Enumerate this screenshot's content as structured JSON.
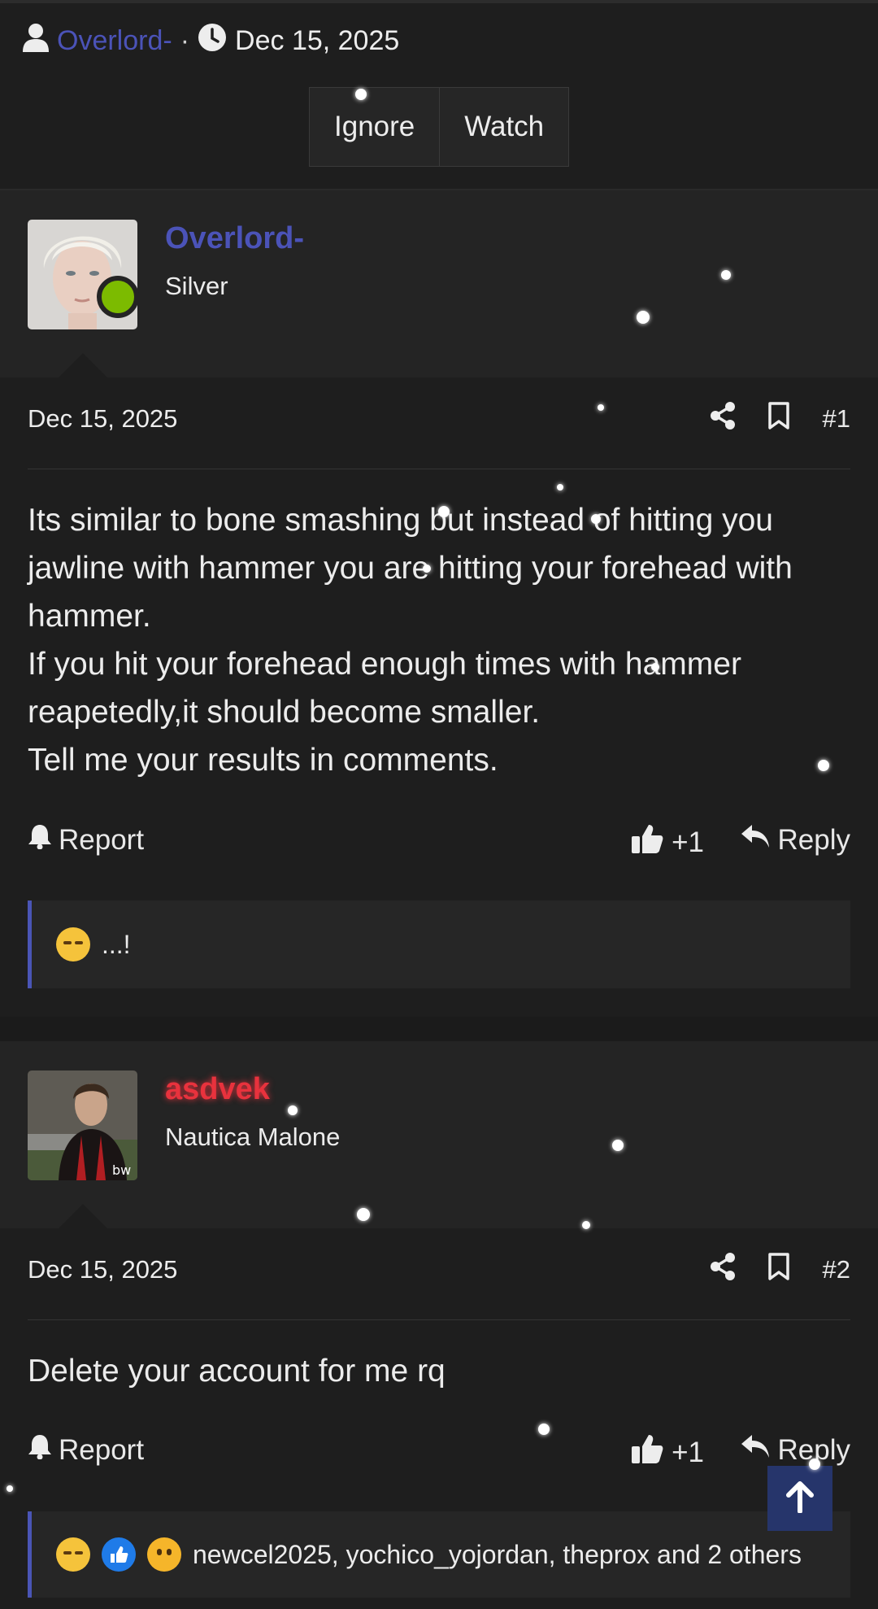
{
  "thread_meta": {
    "author": "Overlord-",
    "separator": "·",
    "date": "Dec 15, 2025"
  },
  "thread_actions": {
    "ignore": "Ignore",
    "watch": "Watch"
  },
  "posts": [
    {
      "username": "Overlord-",
      "user_title": "Silver",
      "username_color": "#4b53b8",
      "online": true,
      "date": "Dec 15, 2025",
      "number": "#1",
      "body": [
        "Its similar to bone smashing but instead of hitting you jawline with hammer you are hitting your forehead with hammer.",
        "If you hit your forehead enough times with hammer reapetedly,it should become smaller.",
        "Tell me your results in comments."
      ],
      "report_label": "Report",
      "like_count": "+1",
      "reply_label": "Reply",
      "reactions_text": "...!",
      "reaction_icons": [
        "crying-laughing-emoji"
      ]
    },
    {
      "username": "asdvek",
      "user_title": "Nautica Malone",
      "username_color": "#e8323d",
      "date": "Dec 15, 2025",
      "number": "#2",
      "body": [
        "Delete your account for me rq"
      ],
      "report_label": "Report",
      "like_count": "+1",
      "reply_label": "Reply",
      "reactions_text": "newcel2025, yochico_yojordan, theprox and 2 others",
      "reaction_icons": [
        "crying-laughing-emoji",
        "thumbs-up-emoji",
        "sad-emoji"
      ]
    }
  ],
  "colors": {
    "background": "#1e1e1e",
    "panel": "#242424",
    "accent": "#4a55b6",
    "online": "#7cbb00"
  }
}
